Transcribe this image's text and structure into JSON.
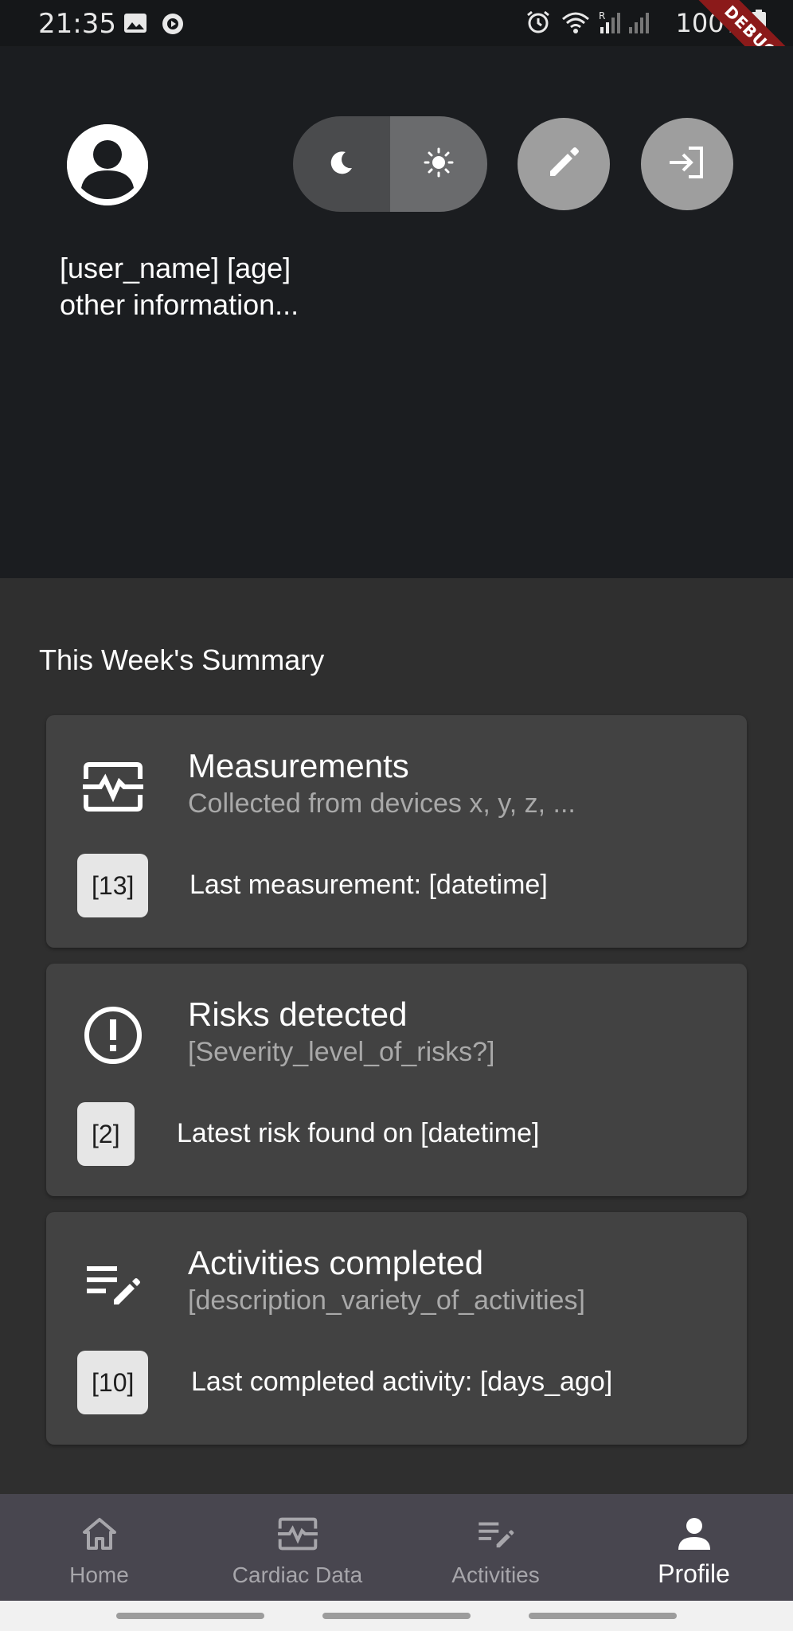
{
  "status_bar": {
    "time": "21:35",
    "battery": "100%",
    "debug_label": "DEBUG",
    "icons": [
      "image-icon",
      "media-icon",
      "alarm-icon",
      "wifi-icon",
      "signal-icon",
      "battery-icon"
    ]
  },
  "header": {
    "user_line1": "[user_name] [age]",
    "user_line2": "other information...",
    "icons": {
      "avatar": "account-circle-icon",
      "dark_mode": "moon-icon",
      "light_mode": "sun-icon",
      "edit": "pencil-icon",
      "logout": "logout-icon"
    }
  },
  "summary": {
    "title": "This Week's Summary",
    "cards": [
      {
        "icon": "monitor-heart-icon",
        "title": "Measurements",
        "subtitle": "Collected from devices x, y, z, ...",
        "badge": "[13]",
        "footer": "Last measurement: [datetime]"
      },
      {
        "icon": "error-outline-icon",
        "title": "Risks detected",
        "subtitle": "[Severity_level_of_risks?]",
        "badge": "[2]",
        "footer": "Latest risk found on [datetime]"
      },
      {
        "icon": "edit-note-icon",
        "title": "Activities completed",
        "subtitle": "[description_variety_of_activities]",
        "badge": "[10]",
        "footer": "Last completed activity: [days_ago]"
      }
    ]
  },
  "nav": {
    "items": [
      {
        "label": "Home",
        "icon": "home-icon"
      },
      {
        "label": "Cardiac Data",
        "icon": "monitor-heart-icon"
      },
      {
        "label": "Activities",
        "icon": "edit-note-icon"
      },
      {
        "label": "Profile",
        "icon": "person-icon"
      }
    ],
    "active": "Profile"
  },
  "colors": {
    "header_bg": "#1b1d20",
    "body_bg": "#2f2f2f",
    "card_bg": "#424242",
    "nav_bg": "#48464f",
    "button_grey": "#9e9e9e"
  }
}
